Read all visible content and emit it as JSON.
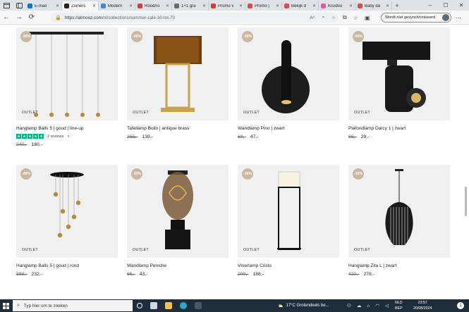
{
  "browser": {
    "tabs": [
      {
        "label": "E-mail",
        "color": "#0078d4",
        "active": false
      },
      {
        "label": "Zomers",
        "color": "#222222",
        "active": true
      },
      {
        "label": "Modern",
        "color": "#3b8ad9",
        "active": false
      },
      {
        "label": "Rood/ro",
        "color": "#d93b3b",
        "active": false
      },
      {
        "label": "1+1 gra",
        "color": "#6b6b6b",
        "active": false
      },
      {
        "label": "Promo v",
        "color": "#d93b3b",
        "active": false
      },
      {
        "label": "Promo |",
        "color": "#e04a4a",
        "active": false
      },
      {
        "label": "Bekijk d",
        "color": "#e04a4a",
        "active": false
      },
      {
        "label": "Kruidvo",
        "color": "#e85a9b",
        "active": false
      },
      {
        "label": "Baby da",
        "color": "#e04a4a",
        "active": false
      }
    ],
    "url_host": "https://atmooz.com",
    "url_path": "/nl/collections/summer-sale-30-tot-70",
    "sync_label": "Wordt niet gesynchroniseerd"
  },
  "products": [
    {
      "badge": "-30%",
      "outlet": "OUTLET",
      "name": "Hanglamp Balls 5 | goud | line-up",
      "has_rating": true,
      "reviews": "2 reviews",
      "review_suffix": "˅",
      "old_price": "240,-",
      "price": "180,-"
    },
    {
      "badge": "-45%",
      "outlet": "OUTLET",
      "name": "Tafellamp Boiίo | antique brass",
      "old_price": "255,-",
      "price": "139,-"
    },
    {
      "badge": "-30%",
      "outlet": "OUTLET",
      "name": "Wandlamp Pino | zwart",
      "old_price": "68,-",
      "price": "47,-"
    },
    {
      "badge": "-65%",
      "outlet": "OUTLET",
      "name": "Plafondlamp Darcy 1 | zwart",
      "old_price": "85,-",
      "price": "29,-"
    },
    {
      "badge": "-40%",
      "outlet": "OUTLET",
      "name": "Hanglamp Balls 5 | goud | rond",
      "old_price": "388,-",
      "price": "232,-"
    },
    {
      "badge": "-33%",
      "outlet": "OUTLET",
      "name": "Wandlamp Peniche",
      "old_price": "65,-",
      "price": "43,-"
    },
    {
      "badge": "-35%",
      "outlet": "OUTLET",
      "name": "Vloerlamp Cristo",
      "old_price": "290,-",
      "price": "188,-"
    },
    {
      "badge": "-35%",
      "outlet": "OUTLET",
      "name": "Hanglamp Zita L | zwart",
      "old_price": "420,-",
      "price": "278,-"
    }
  ],
  "taskbar": {
    "search_placeholder": "Typ hier om te zoeken",
    "weather": "17°C  Grotendeels be...",
    "lang_1": "NLD",
    "lang_2": "BEP",
    "time": "23:57",
    "date": "20/08/2024",
    "notification_count": "1"
  }
}
